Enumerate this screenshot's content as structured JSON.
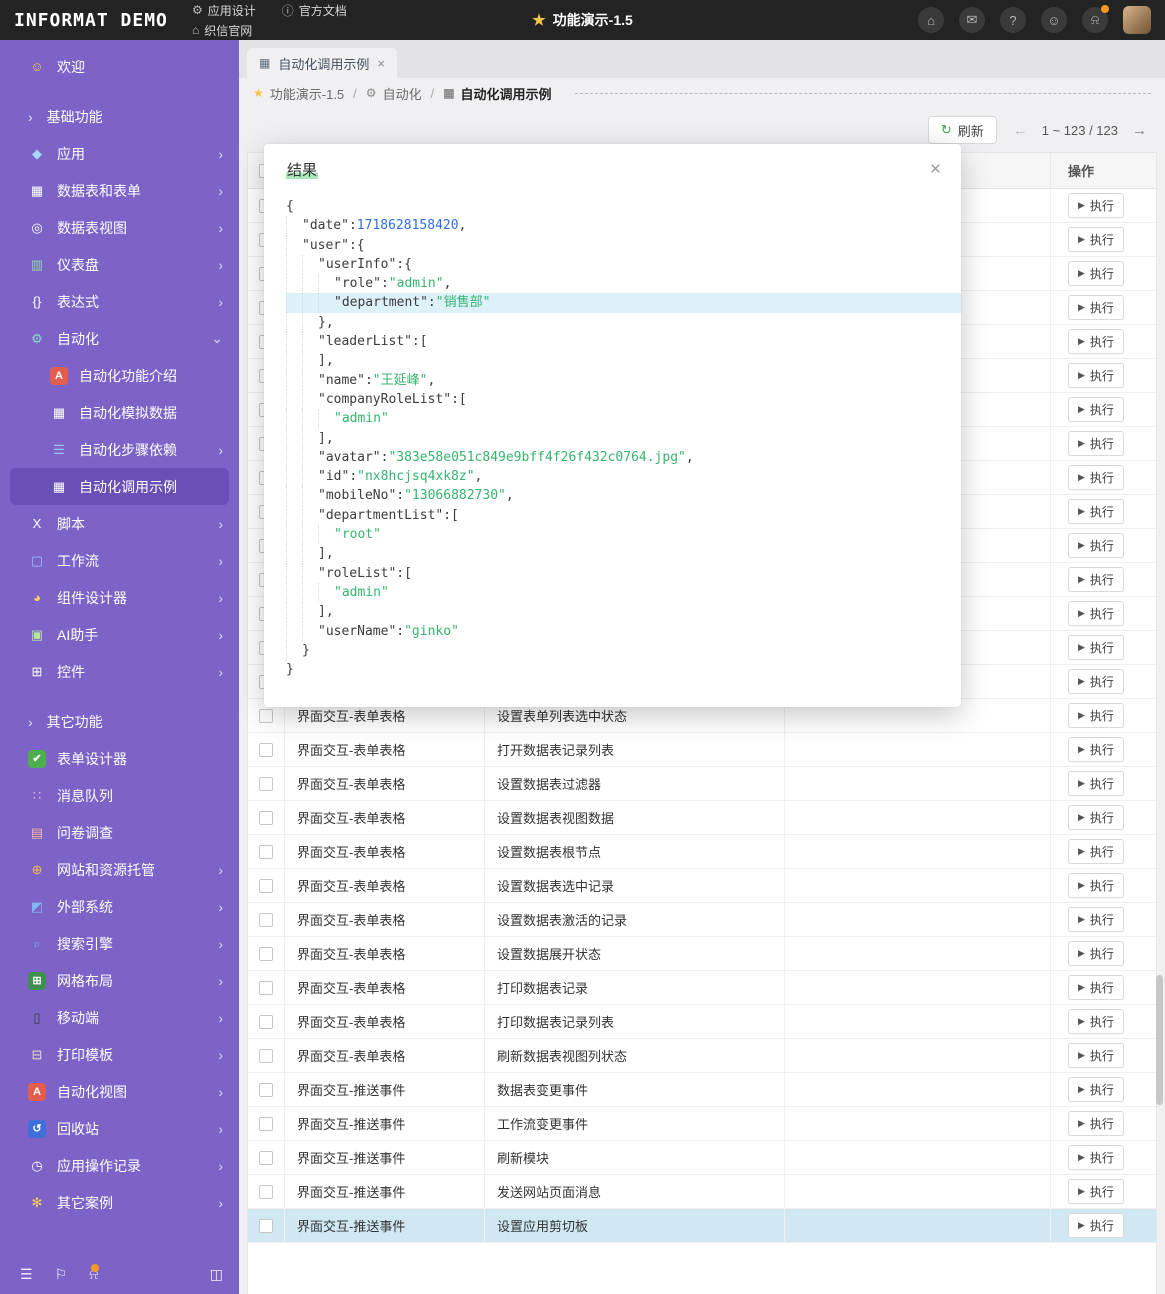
{
  "colors": {
    "topbar_bg": "#232324",
    "sidebar_bg": "#7d63c8",
    "sidebar_active_bg": "#6a4fb6",
    "main_bg": "#f0f0f2",
    "row_highlight": "#cfe8f2",
    "json_string": "#35b46d",
    "json_number": "#2e6fe0",
    "highlight_line_bg": "#ddf1fa",
    "title_marker": "#a9e7b8",
    "notification_badge": "#f59a23"
  },
  "topbar": {
    "logo": "INFORMAT DEMO",
    "nav": [
      {
        "id": "app-design",
        "label": "应用设计",
        "glyph": "⚙",
        "icon": "gear-icon"
      },
      {
        "id": "official-docs",
        "label": "官方文档",
        "glyph": "ⓘ",
        "icon": "info-icon"
      },
      {
        "id": "zhixin-site",
        "label": "织信官网",
        "glyph": "⌂",
        "icon": "home-icon"
      }
    ],
    "title_star": "★",
    "title": "功能演示-1.5",
    "icons": [
      {
        "name": "home-icon",
        "glyph": "⌂"
      },
      {
        "name": "feedback-icon",
        "glyph": "✉"
      },
      {
        "name": "help-icon",
        "glyph": "?"
      },
      {
        "name": "members-icon",
        "glyph": "☺"
      },
      {
        "name": "notifications-icon",
        "glyph": "⍾",
        "badge": true
      }
    ]
  },
  "sidebar": {
    "items": [
      {
        "id": "welcome",
        "label": "欢迎",
        "icon": "smiley-icon",
        "glyph": "☺",
        "iconColor": "#f6c344"
      },
      {
        "type": "section",
        "id": "basic-features",
        "label": "基础功能"
      },
      {
        "id": "apps",
        "label": "应用",
        "icon": "app-icon",
        "glyph": "◆",
        "iconColor": "#a9d7f7",
        "chevron": true
      },
      {
        "id": "tables-forms",
        "label": "数据表和表单",
        "icon": "table-form-icon",
        "glyph": "▦",
        "iconColor": "#ffffff",
        "chevron": true
      },
      {
        "id": "table-views",
        "label": "数据表视图",
        "icon": "table-view-icon",
        "glyph": "◎",
        "iconColor": "#ffffff",
        "chevron": true
      },
      {
        "id": "dashboard",
        "label": "仪表盘",
        "icon": "dashboard-icon",
        "glyph": "▥",
        "iconColor": "#8fd9a8",
        "chevron": true
      },
      {
        "id": "expression",
        "label": "表达式",
        "icon": "braces-icon",
        "glyph": "{}",
        "iconColor": "#ffffff",
        "chevron": true
      },
      {
        "id": "automation",
        "label": "自动化",
        "icon": "automation-icon",
        "glyph": "⚙",
        "iconColor": "#86d8c9",
        "chevron": "down",
        "children": [
          {
            "id": "automation-intro",
            "label": "自动化功能介绍",
            "icon": "doc-a-icon",
            "glyph": "A",
            "iconBg": "#e25d4d",
            "iconColor": "#ffffff"
          },
          {
            "id": "automation-mock-data",
            "label": "自动化模拟数据",
            "icon": "table-icon",
            "glyph": "▦",
            "iconColor": "#ffffff"
          },
          {
            "id": "automation-step-deps",
            "label": "自动化步骤依赖",
            "icon": "layers-icon",
            "glyph": "☰",
            "iconColor": "#9fc3ff",
            "chevron": true
          },
          {
            "id": "automation-call-example",
            "label": "自动化调用示例",
            "icon": "table-icon",
            "glyph": "▦",
            "iconColor": "#ffffff",
            "active": true
          }
        ]
      },
      {
        "id": "script",
        "label": "脚本",
        "icon": "script-icon",
        "glyph": "X",
        "iconColor": "#ffffff",
        "chevron": true
      },
      {
        "id": "workflow",
        "label": "工作流",
        "icon": "workflow-icon",
        "glyph": "▢",
        "iconColor": "#9fc3ff",
        "chevron": true
      },
      {
        "id": "component-designer",
        "label": "组件设计器",
        "icon": "palette-icon",
        "glyph": "◕",
        "iconColor": "#ffd166",
        "chevron": true
      },
      {
        "id": "ai-assistant",
        "label": "AI助手",
        "icon": "ai-icon",
        "glyph": "▣",
        "iconColor": "#b8e6a0",
        "chevron": true
      },
      {
        "id": "widgets",
        "label": "控件",
        "icon": "widget-icon",
        "glyph": "⊞",
        "iconColor": "#ffffff",
        "chevron": true
      },
      {
        "type": "section",
        "id": "other-features",
        "label": "其它功能"
      },
      {
        "id": "form-designer",
        "label": "表单设计器",
        "icon": "check-icon",
        "glyph": "✔",
        "iconBg": "#4cae4c",
        "iconColor": "#ffffff"
      },
      {
        "id": "message-queue",
        "label": "消息队列",
        "icon": "queue-icon",
        "glyph": "∷",
        "iconColor": "#eab6e8"
      },
      {
        "id": "survey",
        "label": "问卷调查",
        "icon": "survey-icon",
        "glyph": "▤",
        "iconColor": "#f0b5a0"
      },
      {
        "id": "hosting",
        "label": "网站和资源托管",
        "icon": "globe-icon",
        "glyph": "⊕",
        "iconColor": "#f3c14b",
        "chevron": true
      },
      {
        "id": "external-systems",
        "label": "外部系统",
        "icon": "external-link-icon",
        "glyph": "◩",
        "iconColor": "#7fb7f0",
        "chevron": true
      },
      {
        "id": "search-engine",
        "label": "搜索引擎",
        "icon": "search-icon",
        "glyph": "⌕",
        "iconColor": "#6fb3e8",
        "chevron": true
      },
      {
        "id": "grid-layout",
        "label": "网格布局",
        "icon": "grid-icon",
        "glyph": "⊞",
        "iconBg": "#3f8f4f",
        "iconColor": "#ffffff",
        "chevron": true
      },
      {
        "id": "mobile",
        "label": "移动端",
        "icon": "mobile-icon",
        "glyph": "▯",
        "iconColor": "#3a3a3a",
        "chevron": true
      },
      {
        "id": "print-template",
        "label": "打印模板",
        "icon": "printer-icon",
        "glyph": "⊟",
        "iconColor": "#e8d9c8",
        "chevron": true
      },
      {
        "id": "automation-view",
        "label": "自动化视图",
        "icon": "doc-a-icon",
        "glyph": "A",
        "iconBg": "#e25d4d",
        "iconColor": "#ffffff",
        "chevron": true
      },
      {
        "id": "recycle-bin",
        "label": "回收站",
        "icon": "recycle-bin-icon",
        "glyph": "↺",
        "iconBg": "#3f6fd8",
        "iconColor": "#ffffff",
        "chevron": true
      },
      {
        "id": "app-operation-log",
        "label": "应用操作记录",
        "icon": "history-icon",
        "glyph": "◷",
        "iconColor": "#ffffff",
        "chevron": true
      },
      {
        "id": "other-cases",
        "label": "其它案例",
        "icon": "bulb-icon",
        "glyph": "✻",
        "iconColor": "#f3d054",
        "chevron": true
      }
    ],
    "footer_icons": [
      {
        "name": "menu-icon",
        "glyph": "☰"
      },
      {
        "name": "flag-icon",
        "glyph": "⚐"
      },
      {
        "name": "bell-icon",
        "glyph": "⍾",
        "badge": true
      }
    ],
    "footer_right_icon": {
      "name": "collapse-panel-icon",
      "glyph": "◫"
    }
  },
  "tab": {
    "glyph": "▦",
    "label": "自动化调用示例",
    "close": "×"
  },
  "breadcrumb": [
    {
      "id": "demo",
      "label": "功能演示-1.5",
      "icon": "star-icon",
      "glyph": "★",
      "glyph_color": "#f6c344"
    },
    {
      "id": "automation",
      "label": "自动化",
      "icon": "toolbox-icon",
      "glyph": "⚙",
      "glyph_color": "#8a8a8a"
    },
    {
      "id": "automation-call-example",
      "label": "自动化调用示例",
      "icon": "table-icon",
      "glyph": "▦",
      "glyph_color": "#8a8a8a",
      "current": true
    }
  ],
  "toolbar": {
    "refresh_glyph": "↻",
    "refresh_label": "刷新",
    "prev_glyph": "←",
    "pagination": "1 ~ 123 / 123",
    "next_glyph": "→"
  },
  "table": {
    "headers": {
      "name": "",
      "desc": "",
      "extra": "",
      "action": "操作"
    },
    "execute_glyph": "▶",
    "execute_label": "执行",
    "rows": [
      {
        "name": "",
        "desc": ""
      },
      {
        "name": "",
        "desc": ""
      },
      {
        "name": "",
        "desc": ""
      },
      {
        "name": "",
        "desc": ""
      },
      {
        "name": "",
        "desc": ""
      },
      {
        "name": "",
        "desc": ""
      },
      {
        "name": "",
        "desc": ""
      },
      {
        "name": "",
        "desc": ""
      },
      {
        "name": "",
        "desc": ""
      },
      {
        "name": "",
        "desc": ""
      },
      {
        "name": "",
        "desc": ""
      },
      {
        "name": "",
        "desc": ""
      },
      {
        "name": "",
        "desc": ""
      },
      {
        "name": "",
        "desc": ""
      },
      {
        "name": "",
        "desc": ""
      },
      {
        "name": "界面交互-表单表格",
        "desc": "设置表单列表选中状态"
      },
      {
        "name": "界面交互-表单表格",
        "desc": "打开数据表记录列表"
      },
      {
        "name": "界面交互-表单表格",
        "desc": "设置数据表过滤器"
      },
      {
        "name": "界面交互-表单表格",
        "desc": "设置数据表视图数据"
      },
      {
        "name": "界面交互-表单表格",
        "desc": "设置数据表根节点"
      },
      {
        "name": "界面交互-表单表格",
        "desc": "设置数据表选中记录"
      },
      {
        "name": "界面交互-表单表格",
        "desc": "设置数据表激活的记录"
      },
      {
        "name": "界面交互-表单表格",
        "desc": "设置数据展开状态"
      },
      {
        "name": "界面交互-表单表格",
        "desc": "打印数据表记录"
      },
      {
        "name": "界面交互-表单表格",
        "desc": "打印数据表记录列表"
      },
      {
        "name": "界面交互-表单表格",
        "desc": "刷新数据表视图列状态"
      },
      {
        "name": "界面交互-推送事件",
        "desc": "数据表变更事件"
      },
      {
        "name": "界面交互-推送事件",
        "desc": "工作流变更事件"
      },
      {
        "name": "界面交互-推送事件",
        "desc": "刷新模块"
      },
      {
        "name": "界面交互-推送事件",
        "desc": "发送网站页面消息"
      },
      {
        "name": "界面交互-推送事件",
        "desc": "设置应用剪切板",
        "hl": true
      }
    ]
  },
  "modal": {
    "title": "结果",
    "close_glyph": "×",
    "json_lines": [
      {
        "ind": 0,
        "seg": [
          [
            "p",
            "{"
          ]
        ]
      },
      {
        "ind": 1,
        "seg": [
          [
            "k",
            "\"date\""
          ],
          [
            "p",
            ":"
          ],
          [
            "n",
            "1718628158420"
          ],
          [
            "p",
            ","
          ]
        ]
      },
      {
        "ind": 1,
        "seg": [
          [
            "k",
            "\"user\""
          ],
          [
            "p",
            ":{"
          ]
        ]
      },
      {
        "ind": 2,
        "seg": [
          [
            "k",
            "\"userInfo\""
          ],
          [
            "p",
            ":{"
          ]
        ]
      },
      {
        "ind": 3,
        "seg": [
          [
            "k",
            "\"role\""
          ],
          [
            "p",
            ":"
          ],
          [
            "str",
            "\"admin\""
          ],
          [
            "p",
            ","
          ]
        ]
      },
      {
        "ind": 3,
        "hl": true,
        "seg": [
          [
            "k",
            "\"department\""
          ],
          [
            "p",
            ":"
          ],
          [
            "str",
            "\"销售部\""
          ]
        ]
      },
      {
        "ind": 2,
        "seg": [
          [
            "p",
            "},"
          ]
        ]
      },
      {
        "ind": 2,
        "seg": [
          [
            "k",
            "\"leaderList\""
          ],
          [
            "p",
            ":["
          ]
        ]
      },
      {
        "ind": 2,
        "seg": [
          [
            "p",
            "],"
          ]
        ]
      },
      {
        "ind": 2,
        "seg": [
          [
            "k",
            "\"name\""
          ],
          [
            "p",
            ":"
          ],
          [
            "str",
            "\"王延峰\""
          ],
          [
            "p",
            ","
          ]
        ]
      },
      {
        "ind": 2,
        "seg": [
          [
            "k",
            "\"companyRoleList\""
          ],
          [
            "p",
            ":["
          ]
        ]
      },
      {
        "ind": 3,
        "seg": [
          [
            "str",
            "\"admin\""
          ]
        ]
      },
      {
        "ind": 2,
        "seg": [
          [
            "p",
            "],"
          ]
        ]
      },
      {
        "ind": 2,
        "seg": [
          [
            "k",
            "\"avatar\""
          ],
          [
            "p",
            ":"
          ],
          [
            "str",
            "\"383e58e051c849e9bff4f26f432c0764.jpg\""
          ],
          [
            "p",
            ","
          ]
        ]
      },
      {
        "ind": 2,
        "seg": [
          [
            "k",
            "\"id\""
          ],
          [
            "p",
            ":"
          ],
          [
            "str",
            "\"nx8hcjsq4xk8z\""
          ],
          [
            "p",
            ","
          ]
        ]
      },
      {
        "ind": 2,
        "seg": [
          [
            "k",
            "\"mobileNo\""
          ],
          [
            "p",
            ":"
          ],
          [
            "str",
            "\"13066882730\""
          ],
          [
            "p",
            ","
          ]
        ]
      },
      {
        "ind": 2,
        "seg": [
          [
            "k",
            "\"departmentList\""
          ],
          [
            "p",
            ":["
          ]
        ]
      },
      {
        "ind": 3,
        "seg": [
          [
            "str",
            "\"root\""
          ]
        ]
      },
      {
        "ind": 2,
        "seg": [
          [
            "p",
            "],"
          ]
        ]
      },
      {
        "ind": 2,
        "seg": [
          [
            "k",
            "\"roleList\""
          ],
          [
            "p",
            ":["
          ]
        ]
      },
      {
        "ind": 3,
        "seg": [
          [
            "str",
            "\"admin\""
          ]
        ]
      },
      {
        "ind": 2,
        "seg": [
          [
            "p",
            "],"
          ]
        ]
      },
      {
        "ind": 2,
        "seg": [
          [
            "k",
            "\"userName\""
          ],
          [
            "p",
            ":"
          ],
          [
            "str",
            "\"ginko\""
          ]
        ]
      },
      {
        "ind": 1,
        "seg": [
          [
            "p",
            "}"
          ]
        ]
      },
      {
        "ind": 0,
        "seg": [
          [
            "p",
            "}"
          ]
        ]
      }
    ]
  }
}
